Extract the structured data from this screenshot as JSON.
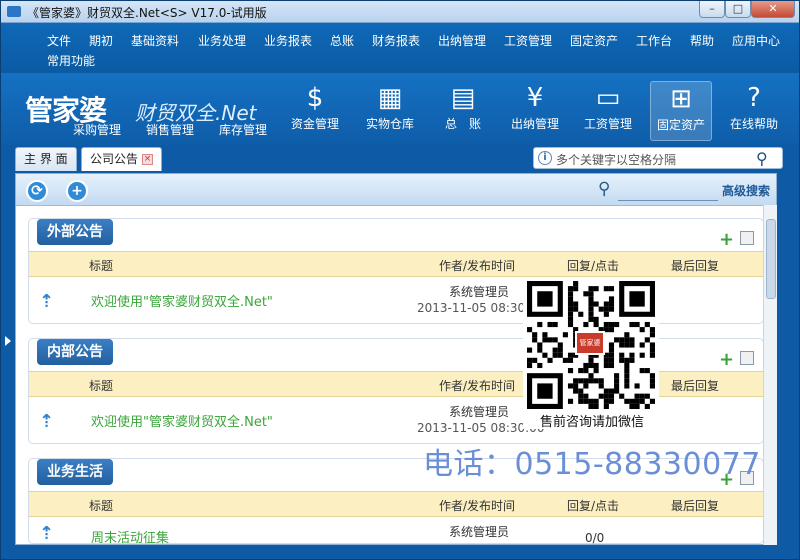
{
  "window": {
    "title": "《管家婆》财贸双全.Net<S> V17.0-试用版",
    "min_glyph": "–",
    "max_glyph": "□",
    "close_glyph": "✕"
  },
  "menu": {
    "row1": [
      "文件",
      "期初",
      "基础资料",
      "业务处理",
      "业务报表",
      "总账",
      "财务报表",
      "出纳管理",
      "工资管理",
      "固定资产",
      "工作台",
      "帮助",
      "应用中心"
    ],
    "row2": [
      "常用功能"
    ]
  },
  "logo": {
    "main": "管家婆",
    "sub": "财贸双全.Net"
  },
  "toolbar": {
    "sub_labels": [
      "采购管理",
      "销售管理",
      "库存管理"
    ],
    "buttons": [
      {
        "label": "资金管理",
        "icon": "$"
      },
      {
        "label": "实物仓库",
        "icon": "▦"
      },
      {
        "label": "总　账",
        "icon": "▤"
      },
      {
        "label": "出纳管理",
        "icon": "¥"
      },
      {
        "label": "工资管理",
        "icon": "▭"
      },
      {
        "label": "固定资产",
        "icon": "⊞"
      },
      {
        "label": "在线帮助",
        "icon": "?"
      }
    ],
    "selected": "固定资产"
  },
  "tabs": [
    "主 界 面",
    "公司公告"
  ],
  "search": {
    "placeholder": "多个关键字以空格分隔"
  },
  "content_toolbar": {
    "advanced_search": "高级搜索",
    "refresh_icon": "⟳",
    "add_icon": "+"
  },
  "columns": {
    "title": "标题",
    "author_time": "作者/发布时间",
    "reply_click": "回复/点击",
    "last_reply": "最后回复"
  },
  "panels": [
    {
      "title": "外部公告",
      "item": "欢迎使用\"管家婆财贸双全.Net\"",
      "author": "系统管理员",
      "date": "2013-11-05 08:30:00",
      "reply": ""
    },
    {
      "title": "内部公告",
      "item": "欢迎使用\"管家婆财贸双全.Net\"",
      "author": "系统管理员",
      "date": "2013-11-05 08:30:00",
      "reply": ""
    },
    {
      "title": "业务生活",
      "item": "周末活动征集",
      "author": "系统管理员",
      "date": "",
      "reply": "0/0"
    }
  ],
  "qr": {
    "caption": "售前咨询请加微信",
    "logo_text": "管家婆"
  },
  "phone": "电话：0515-88330077"
}
